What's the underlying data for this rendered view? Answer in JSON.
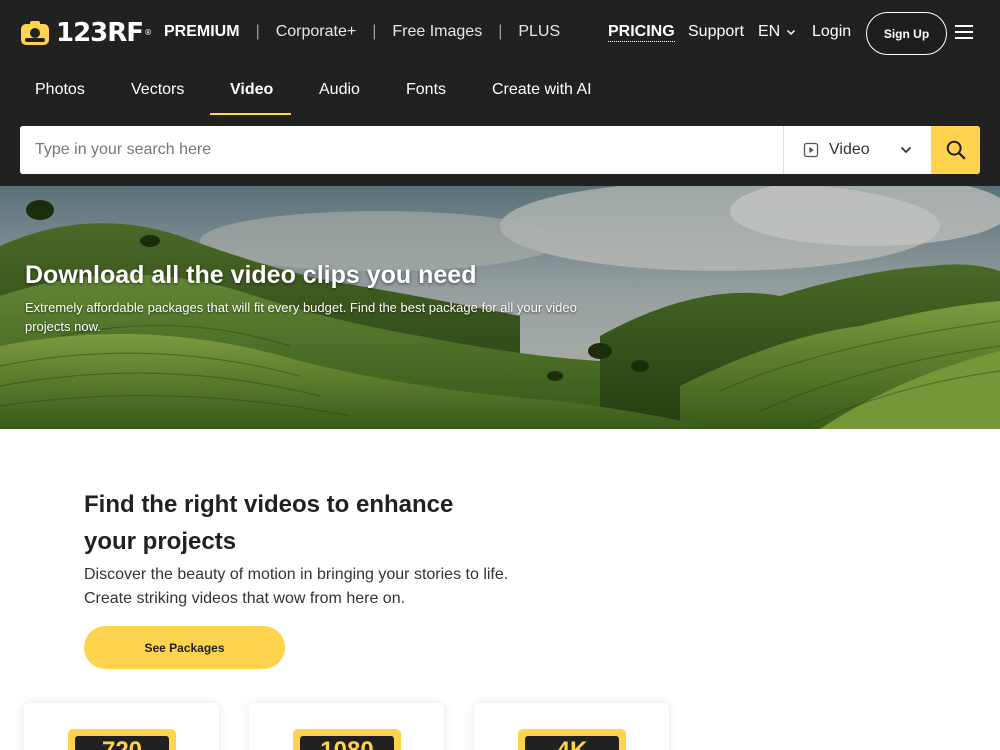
{
  "header": {
    "logo": "123RF",
    "logo_mark": "®",
    "links": [
      "PREMIUM",
      "Corporate+",
      "Free Images",
      "PLUS"
    ],
    "separator": "|",
    "pricing": "PRICING",
    "support": "Support",
    "language": "EN",
    "login": "Login",
    "signup": "Sign Up"
  },
  "tabs": [
    "Photos",
    "Vectors",
    "Video",
    "Audio",
    "Fonts",
    "Create with AI"
  ],
  "active_tab": "Video",
  "search": {
    "placeholder": "Type in your search here",
    "type": "Video"
  },
  "hero": {
    "title": "Download all the video clips you need",
    "subtitle": "Extremely affordable packages that will fit every budget. Find the best package for all your video projects now."
  },
  "section": {
    "title": "Find the right videos to enhance your projects",
    "text": "Discover the beauty of motion in bringing your stories to life. Create striking videos that wow from here on.",
    "button": "See Packages"
  },
  "cards": [
    {
      "badge": "720"
    },
    {
      "badge": "1080"
    },
    {
      "badge": "4K"
    }
  ],
  "colors": {
    "header_bg": "#212121",
    "accent": "#ffd34e",
    "text_dark": "#212121"
  },
  "icons": [
    "camera-logo-icon",
    "chevron-down-icon",
    "menu-icon",
    "play-icon",
    "search-icon"
  ]
}
